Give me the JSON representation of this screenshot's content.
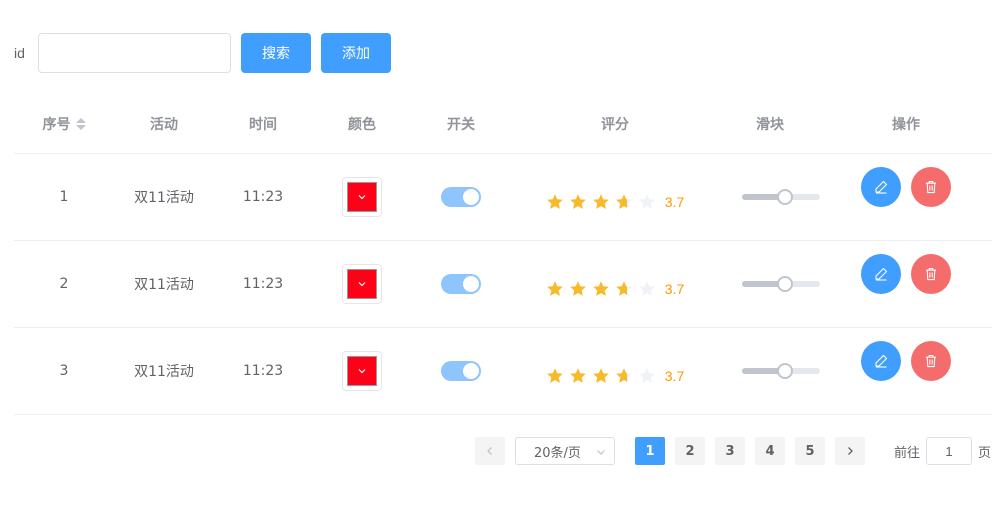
{
  "search": {
    "label": "id",
    "value": "",
    "placeholder": "",
    "search_button": "搜索",
    "add_button": "添加"
  },
  "table": {
    "headers": [
      "序号",
      "活动",
      "时间",
      "颜色",
      "开关",
      "评分",
      "滑块",
      "操作"
    ],
    "rows": [
      {
        "index": "1",
        "activity": "双11活动",
        "time": "11:23",
        "color": "#ff0019",
        "switch_on": true,
        "rating": 3.7,
        "rating_text": "3.7",
        "slider_percent": 55
      },
      {
        "index": "2",
        "activity": "双11活动",
        "time": "11:23",
        "color": "#ff0019",
        "switch_on": true,
        "rating": 3.7,
        "rating_text": "3.7",
        "slider_percent": 55
      },
      {
        "index": "3",
        "activity": "双11活动",
        "time": "11:23",
        "color": "#ff0019",
        "switch_on": true,
        "rating": 3.7,
        "rating_text": "3.7",
        "slider_percent": 55
      }
    ],
    "icons": {
      "sort": "sort-caret-icon",
      "edit": "edit-pencil-icon",
      "delete": "trash-icon",
      "color_dropdown": "chevron-down-icon"
    }
  },
  "pagination": {
    "page_size": "20条/页",
    "pages": [
      "1",
      "2",
      "3",
      "4",
      "5"
    ],
    "current_page": "1",
    "goto_prefix": "前往",
    "goto_value": "1",
    "goto_suffix": "页"
  },
  "colors": {
    "primary": "#409eff",
    "danger": "#f56c6c",
    "star": "#f7ba2a",
    "star_empty": "#eff2f7",
    "rating_text": "#ff9900"
  }
}
